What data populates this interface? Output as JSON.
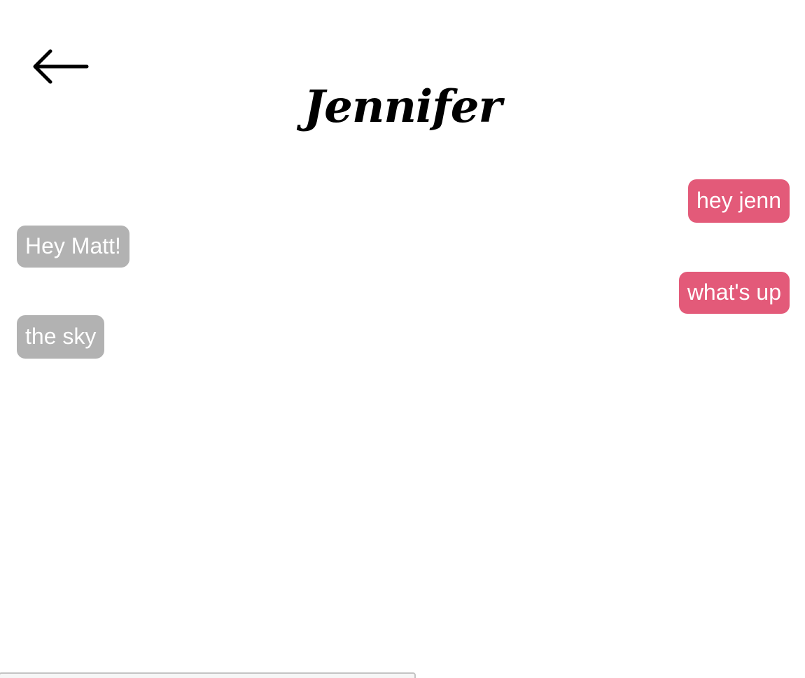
{
  "header": {
    "title": "Jennifer",
    "back_icon": "arrow-left-icon"
  },
  "colors": {
    "sent_bubble": "#e35a79",
    "received_bubble": "#b2b2b2",
    "bubble_text": "#ffffff"
  },
  "messages": [
    {
      "direction": "sent",
      "text": "hey jenn"
    },
    {
      "direction": "received",
      "text": "Hey Matt!"
    },
    {
      "direction": "sent",
      "text": "what's up"
    },
    {
      "direction": "received",
      "text": "the sky"
    }
  ],
  "composer": {
    "value": "",
    "placeholder": ""
  }
}
